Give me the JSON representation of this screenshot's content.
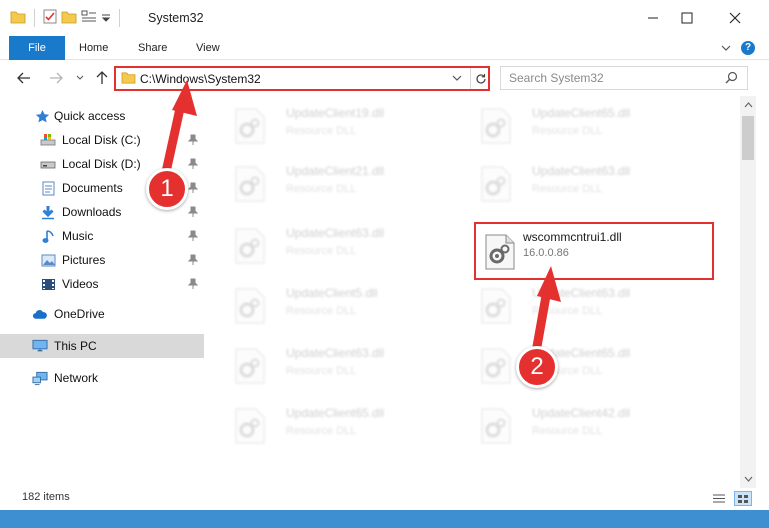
{
  "window": {
    "title": "System32"
  },
  "ribbon": {
    "tabs": [
      "File",
      "Home",
      "Share",
      "View"
    ]
  },
  "address_bar": {
    "path": "C:\\Windows\\System32"
  },
  "search": {
    "placeholder": "Search System32"
  },
  "sidebar": {
    "items": [
      {
        "label": "Quick access",
        "icon": "star-icon"
      },
      {
        "label": "Local Disk (C:)",
        "icon": "drive-icon"
      },
      {
        "label": "Local Disk (D:)",
        "icon": "drive-icon"
      },
      {
        "label": "Documents",
        "icon": "documents-icon"
      },
      {
        "label": "Downloads",
        "icon": "downloads-icon"
      },
      {
        "label": "Music",
        "icon": "music-icon"
      },
      {
        "label": "Pictures",
        "icon": "pictures-icon"
      },
      {
        "label": "Videos",
        "icon": "videos-icon"
      },
      {
        "label": "OneDrive",
        "icon": "cloud-icon"
      },
      {
        "label": "This PC",
        "icon": "computer-icon"
      },
      {
        "label": "Network",
        "icon": "network-icon"
      }
    ],
    "selected": "This PC"
  },
  "files": {
    "left_column": [
      {
        "name": "UpdateClient19.dll",
        "desc": "Resource DLL"
      },
      {
        "name": "UpdateClient21.dll",
        "desc": "Resource DLL"
      },
      {
        "name": "UpdateClient63.dll",
        "desc": "Resource DLL"
      },
      {
        "name": "UpdateClient5.dll",
        "desc": "Resource DLL"
      },
      {
        "name": "UpdateClient63.dll",
        "desc": "Resource DLL"
      },
      {
        "name": "UpdateClient65.dll",
        "desc": "Resource DLL"
      }
    ],
    "right_column": [
      {
        "name": "UpdateClient65.dll",
        "desc": "Resource DLL"
      },
      {
        "name": "UpdateClient63.dll",
        "desc": "Resource DLL"
      },
      {
        "name": "UpdateClient63.dll",
        "desc": "Resource DLL"
      },
      {
        "name": "UpdateClient65.dll",
        "desc": "Resource DLL"
      },
      {
        "name": "UpdateClient42.dll",
        "desc": "Resource DLL"
      }
    ],
    "highlighted": {
      "name": "wscommcntrui1.dll",
      "desc": "16.0.0.86"
    }
  },
  "status": {
    "item_count": "182 items"
  },
  "annotations": {
    "step1": "1",
    "step2": "2",
    "color": "#e53030"
  },
  "colors": {
    "accent": "#1979ca",
    "highlight": "#e53030",
    "selected_bg": "#d9d9d9"
  }
}
